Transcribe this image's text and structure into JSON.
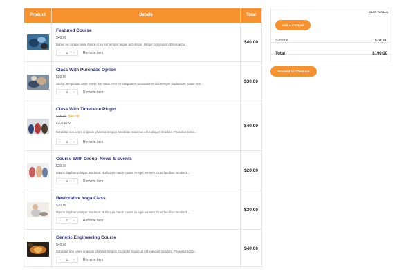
{
  "table": {
    "headers": {
      "product": "Product",
      "details": "Details",
      "total": "Total"
    }
  },
  "items": [
    {
      "title": "Featured Course",
      "price": "$40.00",
      "description": "Donec eu congue sem. Fusce ut eu est semper augue accumsan. Integer consequat ultrices accu...",
      "quantity": "1",
      "minus": "-",
      "plus": "+",
      "remove": "Remove item",
      "total": "$40.00"
    },
    {
      "title": "Class With Purchase Option",
      "price": "$30.00",
      "description": "Sed ut perspiciatis unde omnis iste natus error sit voluptatem accusantium doloremque laudantium, totam rem...",
      "quantity": "1",
      "minus": "-",
      "plus": "+",
      "remove": "Remove item",
      "total": "$30.00"
    },
    {
      "title": "Class With Timetable Plugin",
      "old_price": "$45.00",
      "new_price": "$40.00",
      "save": "SAVE $5.00",
      "description": "Curabitur non lorem id ipsum pharetra tempus. Curabitur maximus est a aliquet tincidunt. Phasellus tortor...",
      "quantity": "1",
      "minus": "-",
      "plus": "+",
      "remove": "Remove item",
      "total": "$40.00"
    },
    {
      "title": "Course With Group, News & Events",
      "price": "$20.00",
      "description": "Mauris dapibus volutpat maximus. Nulla quis mauris quam. In eget est sem. Cras faucibus hendrerit...",
      "quantity": "1",
      "minus": "-",
      "plus": "+",
      "remove": "Remove item",
      "total": "$20.00"
    },
    {
      "title": "Restorative Yoga Class",
      "price": "$20.00",
      "description": "Mauris dapibus volutpat maximus. Nulla quis mauris quam. In eget est sem. Cras faucibus hendrerit...",
      "quantity": "1",
      "minus": "-",
      "plus": "+",
      "remove": "Remove item",
      "total": "$20.00"
    },
    {
      "title": "Genetic Engineering Course",
      "price": "$40.00",
      "description": "Curabitur non lorem id ipsum pharetra tempus. Curabitur maximus est a aliquet tincidunt. Phasellus tortor...",
      "quantity": "1",
      "minus": "-",
      "plus": "+",
      "remove": "Remove item",
      "total": "$40.00"
    }
  ],
  "cart_totals": {
    "title": "CART TOTALS",
    "coupon_button": "Add A Coupon",
    "subtotal_label": "Subtotal",
    "subtotal_value": "$190.00",
    "total_label": "Total",
    "total_value": "$190.00"
  },
  "checkout_button": "Proceed To Checkout",
  "colors": {
    "accent": "#f7922f",
    "title": "#2b2f7c",
    "sale": "#d89a00"
  }
}
